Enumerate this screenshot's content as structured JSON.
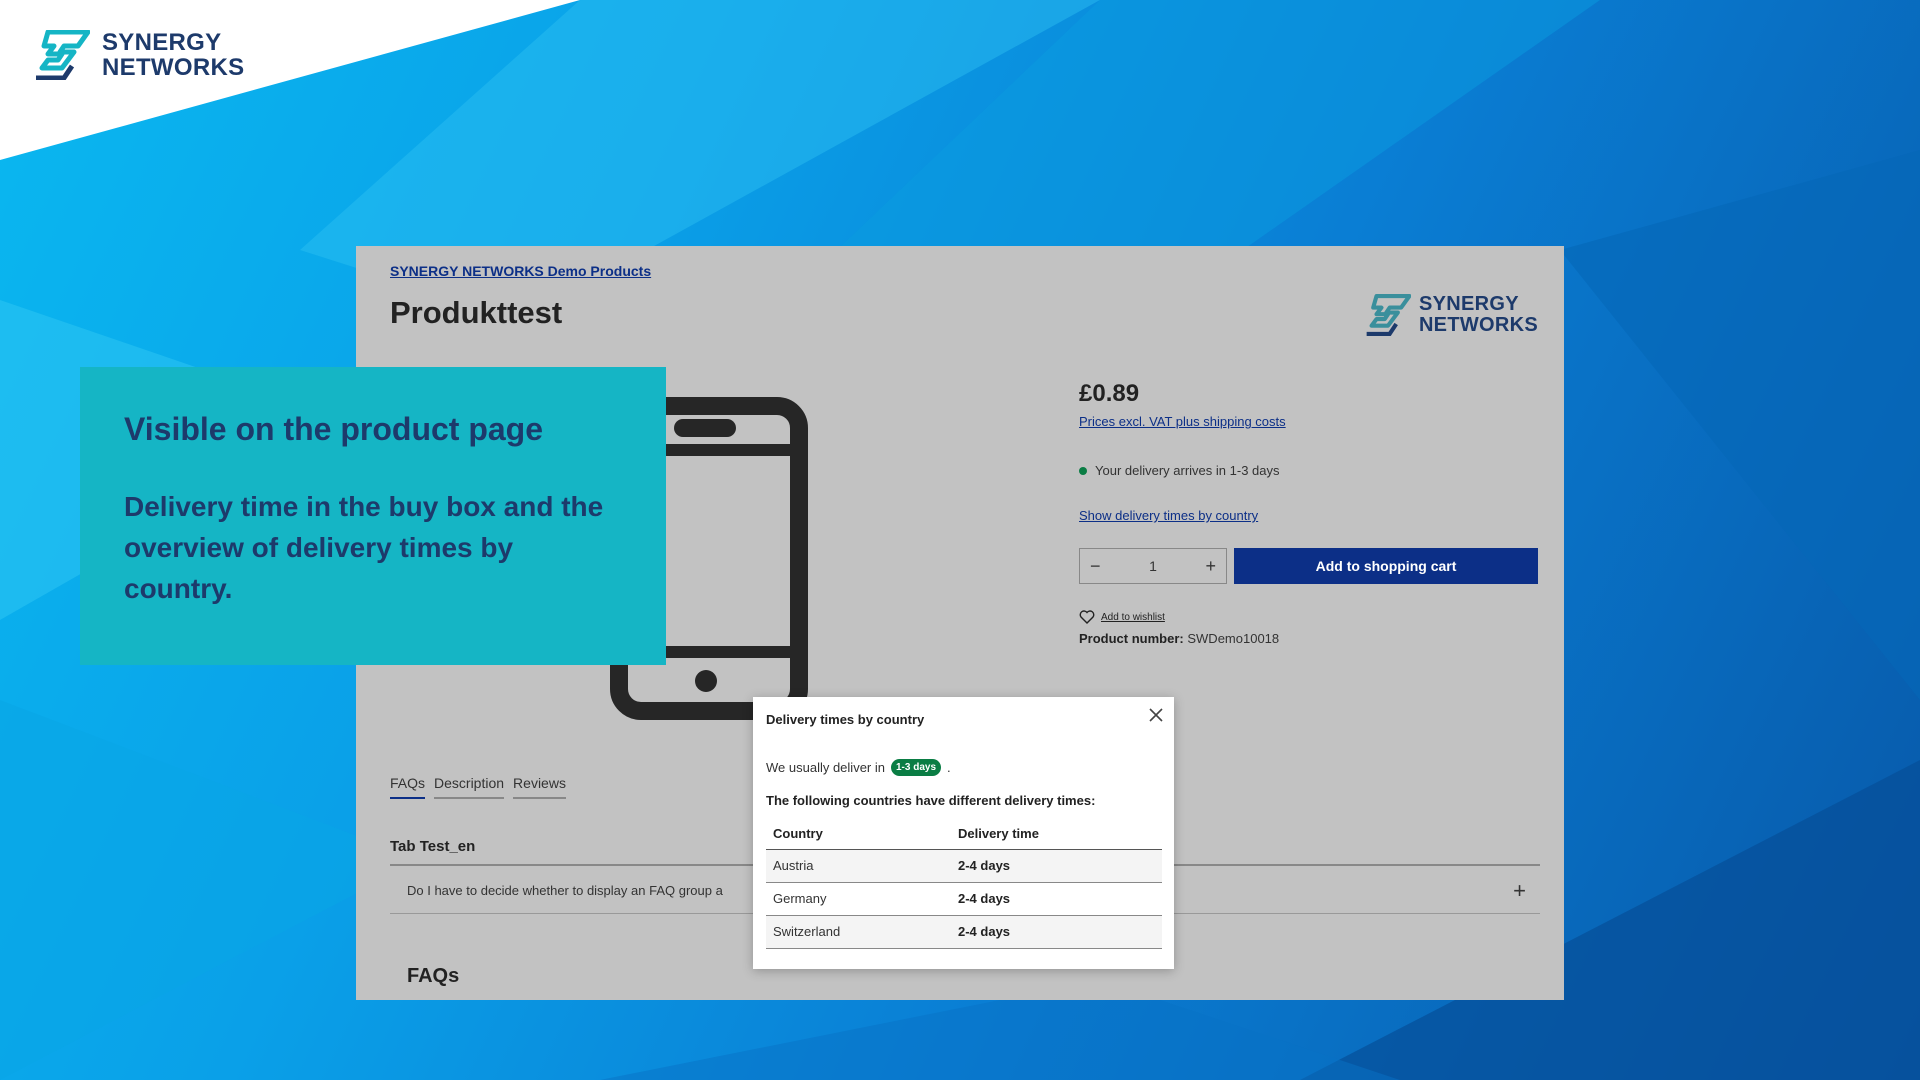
{
  "brand": {
    "line1": "SYNERGY",
    "line2": "NETWORKS"
  },
  "product_page": {
    "breadcrumb": "SYNERGY NETWORKS Demo Products",
    "title": "Produkttest",
    "price": "£0.89",
    "vat_link": "Prices excl. VAT plus shipping costs",
    "delivery": "Your delivery arrives in 1-3 days",
    "country_link": "Show delivery times by country",
    "quantity": "1",
    "qty_minus": "−",
    "qty_plus": "+",
    "add_to_cart": "Add to shopping cart",
    "wishlist": "Add to wishlist",
    "product_number_label": "Product number:",
    "product_number": "SWDemo10018",
    "tabs": [
      "FAQs",
      "Description",
      "Reviews"
    ],
    "tab_title": "Tab Test_en",
    "faq_question": "Do I have to decide whether to display an FAQ group a",
    "faq_plus": "+",
    "faqs_heading": "FAQs"
  },
  "popup": {
    "title": "Delivery times by country",
    "usually_prefix": "We usually deliver in",
    "usually_badge": "1-3 days",
    "usually_suffix": ".",
    "different": "The following countries have different delivery times:",
    "columns": [
      "Country",
      "Delivery time"
    ],
    "rows": [
      {
        "country": "Austria",
        "time": "2-4 days"
      },
      {
        "country": "Germany",
        "time": "2-4 days"
      },
      {
        "country": "Switzerland",
        "time": "2-4 days"
      }
    ]
  },
  "overlay": {
    "heading": "Visible on the product page",
    "text": "Delivery time in the buy box and the overview of delivery times by country."
  },
  "colors": {
    "brand_navy": "#0c2f87",
    "teal": "#15b5c5",
    "badge_green": "#0a7d44"
  },
  "icons": [
    "synergy-logo-icon",
    "smartphone-icon",
    "heart-icon",
    "close-icon"
  ]
}
